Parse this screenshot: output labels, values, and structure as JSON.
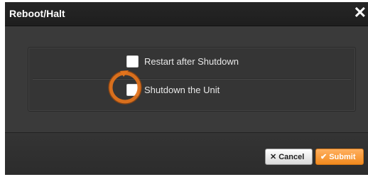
{
  "dialog": {
    "title": "Reboot/Halt",
    "close_glyph": "✕"
  },
  "options": [
    {
      "label": "Restart after Shutdown",
      "checked": false,
      "icon": "checkbox-unchecked"
    },
    {
      "label": "Shutdown the Unit",
      "checked": false,
      "icon": "checkbox-unchecked"
    }
  ],
  "footer": {
    "cancel_glyph": "✕",
    "cancel_label": "Cancel",
    "submit_glyph": "✔",
    "submit_label": "Submit"
  },
  "colors": {
    "dialog_bg": "#3c3c3c",
    "titlebar_bg": "#222222",
    "accent_orange": "#f28a1e",
    "highlight_ring": "#e2731c"
  }
}
